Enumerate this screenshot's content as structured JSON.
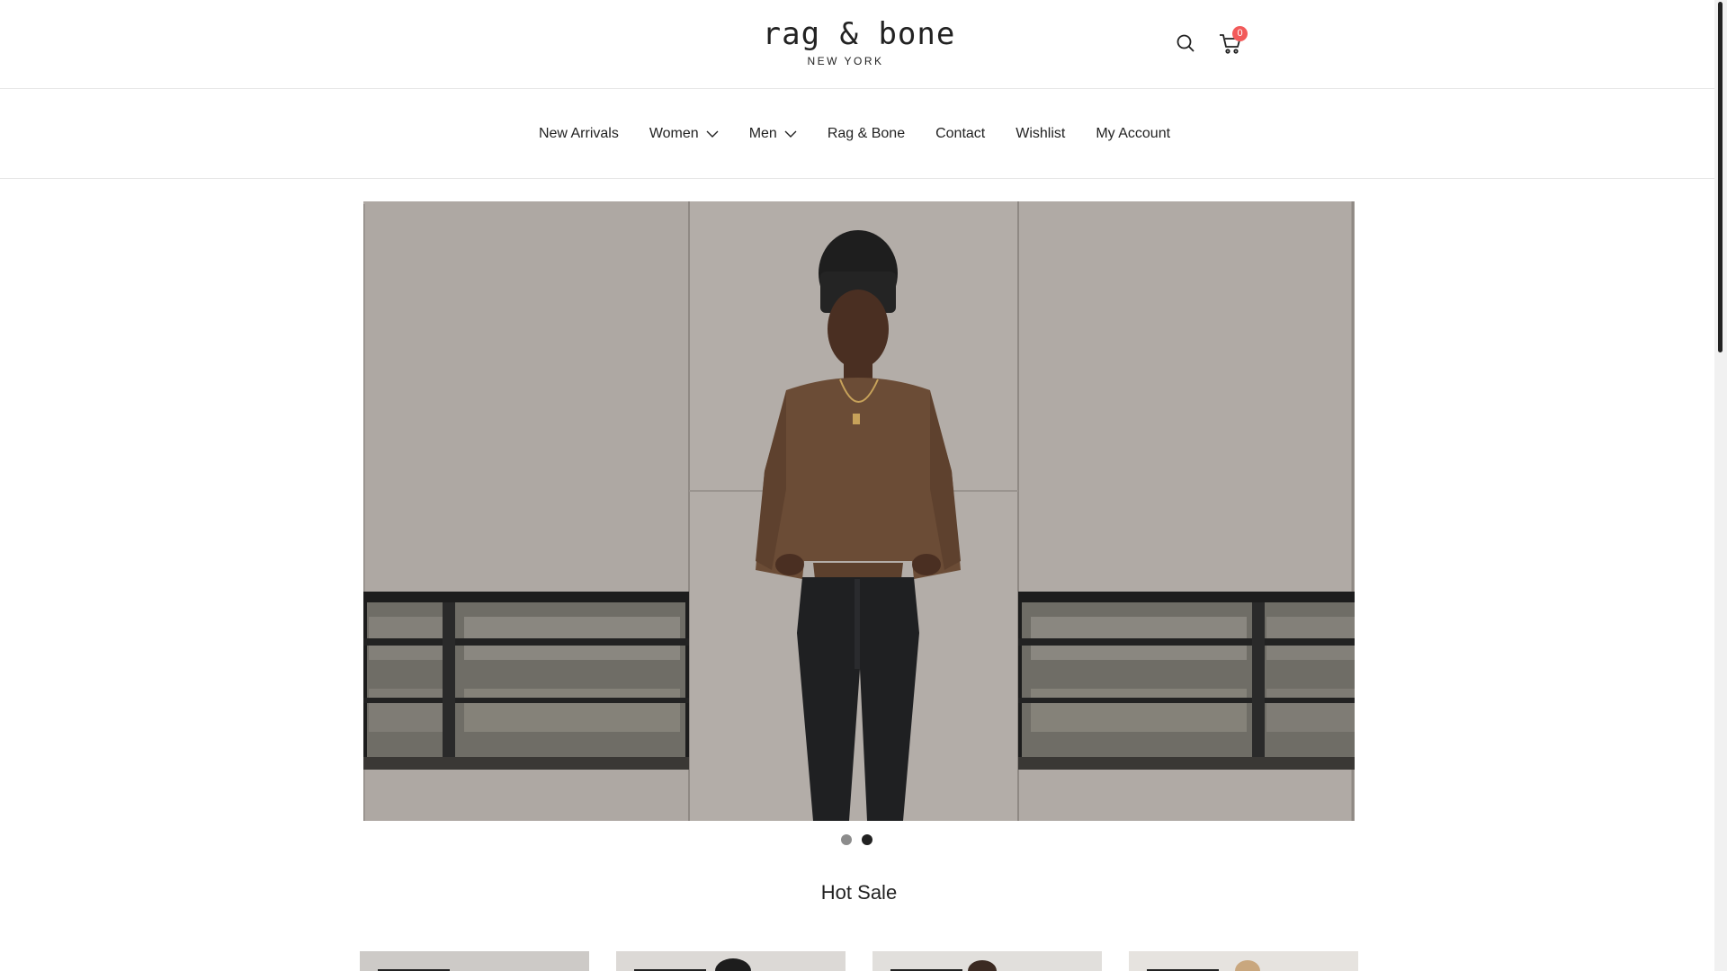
{
  "brand": {
    "name": "rag & bone",
    "sub": "NEW YORK"
  },
  "header": {
    "search_icon": "search-icon",
    "cart_icon": "cart-icon",
    "cart_count": "0",
    "cart_badge_color": "#f25a5a"
  },
  "nav": {
    "items": [
      {
        "label": "New Arrivals",
        "has_dropdown": false
      },
      {
        "label": "Women",
        "has_dropdown": true
      },
      {
        "label": "Men",
        "has_dropdown": true
      },
      {
        "label": "Rag & Bone",
        "has_dropdown": false
      },
      {
        "label": "Contact",
        "has_dropdown": false
      },
      {
        "label": "Wishlist",
        "has_dropdown": false
      },
      {
        "label": "My Account",
        "has_dropdown": false
      }
    ]
  },
  "hero": {
    "slides_total": 2,
    "active_slide": 2
  },
  "section": {
    "title": "Hot Sale"
  },
  "products": {
    "count_visible": 4
  }
}
